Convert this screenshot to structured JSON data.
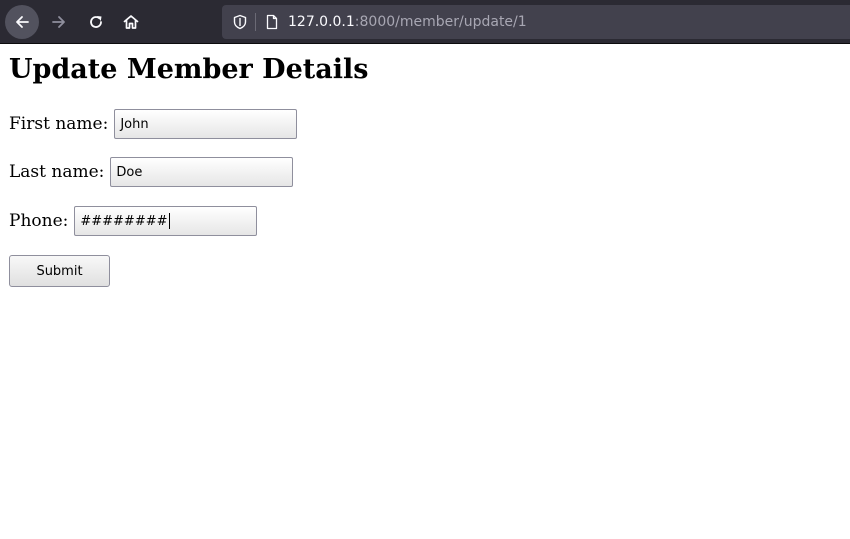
{
  "browser": {
    "url_host": "127.0.0.1",
    "url_rest": ":8000/member/update/1",
    "icons": {
      "back": "arrow-left-icon",
      "forward": "arrow-right-icon",
      "reload": "reload-icon",
      "home": "home-icon",
      "tracking": "shield-icon",
      "page": "page-icon"
    }
  },
  "page": {
    "title": "Update Member Details",
    "form": {
      "first_name_label": "First name:",
      "first_name_value": "John",
      "last_name_label": "Last name:",
      "last_name_value": "Doe",
      "phone_label": "Phone:",
      "phone_value": "########",
      "submit_label": "Submit"
    }
  },
  "colors": {
    "toolbar_bg": "#2b2a33",
    "urlbar_bg": "#42414d",
    "url_host": "#fbfbfe",
    "url_rest": "#a8a7b3"
  }
}
